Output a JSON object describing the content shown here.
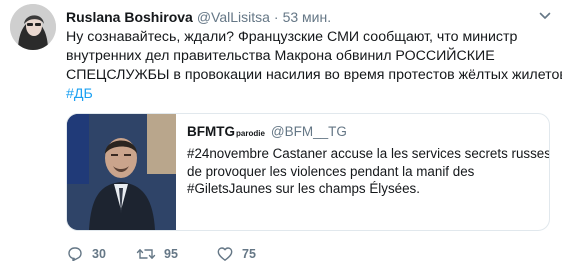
{
  "author": {
    "display_name": "Ruslana Boshirova",
    "handle": "@ValLisitsa",
    "separator": "·",
    "time": "53 мин."
  },
  "tweet": {
    "text_lines": [
      "Ну сознавайтесь, ждали? Французские СМИ сообщают, что  министр",
      "внутренних дел правительства Макрона обвинил РОССИЙСКИЕ",
      "СПЕЦСЛУЖБЫ в провокации насилия во время протестов жёлтых жилетов."
    ],
    "hashtag": "#ДБ"
  },
  "quoted": {
    "display_name": "BFMTG",
    "name_suffix": "parodie",
    "handle": "@BFM__TG",
    "text_lines": [
      "#24novembre Castaner accuse la les services secrets russes",
      "de provoquer  les violences pendant la manif des",
      "#GiletsJaunes sur les champs Élysées."
    ]
  },
  "actions": {
    "reply_count": "30",
    "retweet_count": "95",
    "like_count": "75"
  },
  "icons": {
    "reply": "reply-icon",
    "retweet": "retweet-icon",
    "like": "heart-icon",
    "more": "chevron-down-icon"
  },
  "colors": {
    "link": "#1da1f2",
    "muted": "#657786",
    "text": "#14171a",
    "border": "#e1e8ed"
  }
}
